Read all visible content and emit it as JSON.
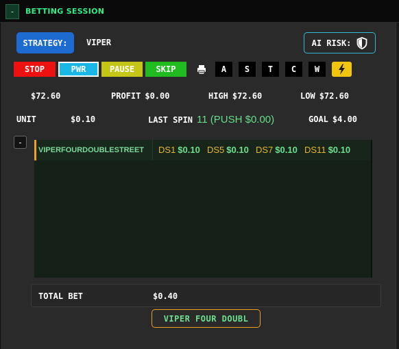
{
  "header": {
    "collapse_label": "-",
    "title": "BETTING SESSION"
  },
  "strategy": {
    "button_label": "STRATEGY:",
    "name": "VIPER"
  },
  "ai_risk": {
    "label": "AI RISK:",
    "icon": "shield-icon"
  },
  "controls": {
    "stop": "STOP",
    "pwr": "PWR",
    "pause": "PAUSE",
    "skip": "SKIP"
  },
  "letters": [
    "A",
    "S",
    "T",
    "C",
    "W"
  ],
  "icons": {
    "printer": "printer-icon",
    "bolt": "lightning-bolt-icon"
  },
  "stats": {
    "balance": "$72.60",
    "profit_label": "PROFIT",
    "profit": "$0.00",
    "high_label": "HIGH",
    "high": "$72.60",
    "low_label": "LOW",
    "low": "$72.60",
    "unit_label": "UNIT",
    "unit": "$0.10",
    "last_spin_label": "LAST SPIN",
    "last_spin": "11 (PUSH $0.00)",
    "goal_label": "GOAL",
    "goal": "$4.00"
  },
  "section_toggle": "-",
  "bets": {
    "name": "VIPERFOURDOUBLESTREET",
    "items": [
      {
        "label": "DS1",
        "amount": "$0.10"
      },
      {
        "label": "DS5",
        "amount": "$0.10"
      },
      {
        "label": "DS7",
        "amount": "$0.10"
      },
      {
        "label": "DS11",
        "amount": "$0.10"
      }
    ]
  },
  "total": {
    "label": "TOTAL BET",
    "value": "$0.40"
  },
  "bottom_button": "VIPER FOUR DOUBL",
  "colors": {
    "accent_green": "#33ee88",
    "stop": "#ee1111",
    "pwr": "#19b6e6",
    "pause": "#c6c618",
    "skip": "#1fbb1f",
    "bolt": "#f2c60f",
    "strategy": "#1d6bd1"
  }
}
